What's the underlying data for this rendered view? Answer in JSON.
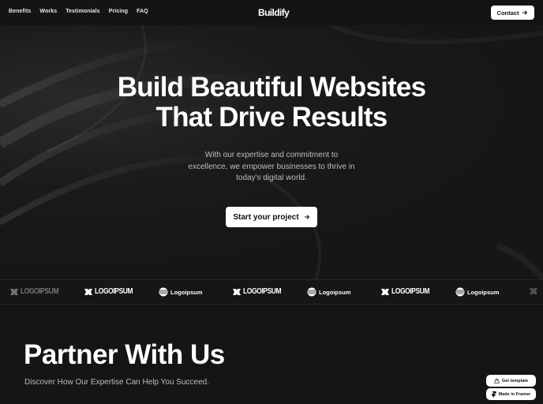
{
  "nav": {
    "links": [
      "Benefits",
      "Works",
      "Testimonials",
      "Pricing",
      "FAQ"
    ],
    "brand": "Buildify",
    "contact_label": "Contact",
    "contact_icon": "arrow-right-icon"
  },
  "hero": {
    "title_line1": "Build Beautiful Websites",
    "title_line2": "That Drive Results",
    "subtitle_lines": [
      "With our expertise and commitment to",
      "excellence, we empower businesses to thrive in",
      "today's digital world."
    ],
    "cta_label": "Start your project",
    "cta_icon": "arrow-right-icon"
  },
  "logos": {
    "items": [
      {
        "style": "icon-caps",
        "label": "LOGOIPSUM"
      },
      {
        "style": "icon-caps",
        "label": "LOGOIPSUM"
      },
      {
        "style": "globe",
        "label": "Logoipsum"
      },
      {
        "style": "icon-caps",
        "label": "LOGOIPSUM"
      },
      {
        "style": "globe",
        "label": "Logoipsum"
      },
      {
        "style": "icon-caps",
        "label": "LOGOIPSUM"
      },
      {
        "style": "globe",
        "label": "Logoipsum"
      }
    ]
  },
  "partner": {
    "title": "Partner With Us",
    "subtitle": "Discover How Our Expertise Can Help You Succeed."
  },
  "framer": {
    "get_template": "Get template",
    "made_in_framer": "Made in Framer"
  },
  "colors": {
    "background": "#151515",
    "button_bg": "#ffffff",
    "button_text": "#111111",
    "muted_text": "#bdbdbd"
  }
}
